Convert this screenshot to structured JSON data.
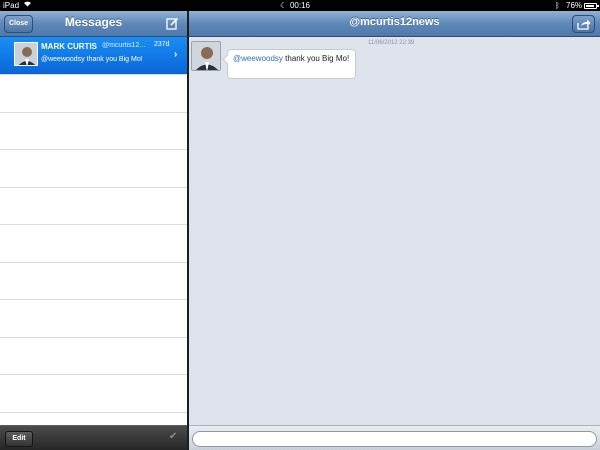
{
  "status_bar": {
    "device": "iPad",
    "time": "00:16",
    "battery": "76%",
    "battery_level": 0.76
  },
  "messages_panel": {
    "close_label": "Close",
    "title": "Messages",
    "edit_label": "Edit",
    "conversations": [
      {
        "name": "MARK CURTIS",
        "handle": "@mcurtis12...",
        "age": "237d",
        "preview": "@weewoodsy thank you Big Mo!"
      }
    ]
  },
  "conversation": {
    "title": "@mcurtis12news",
    "timestamp": "11/06/2012 22:39",
    "message": {
      "mention": "@weewoodsy",
      "text": " thank you Big Mo!"
    },
    "input_value": ""
  },
  "icons": {
    "compose": "compose-icon",
    "share": "share-icon",
    "chevron": "chevron-right-icon",
    "checkmark": "checkmark-icon"
  },
  "colors": {
    "nav_blue": "#5f88b8",
    "selected_row": "#0a66d8",
    "conversation_bg": "#dfe4ec",
    "mention": "#2f6fc0"
  }
}
